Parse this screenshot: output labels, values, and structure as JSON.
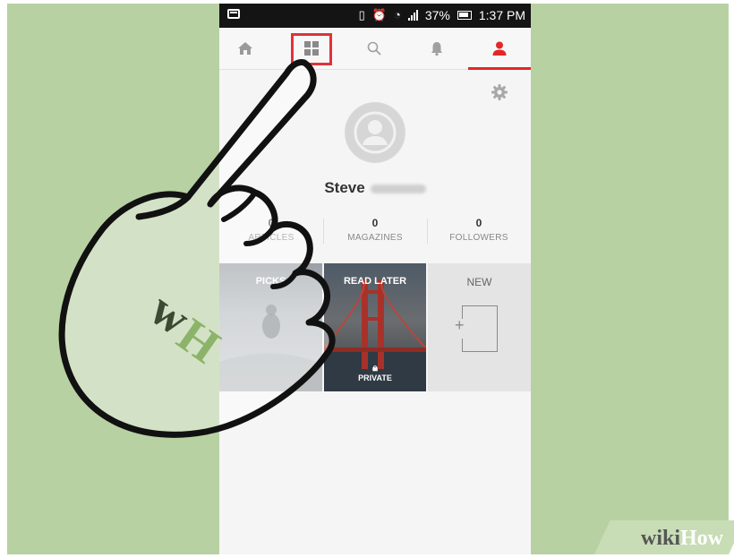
{
  "status_bar": {
    "battery": "37%",
    "time": "1:37 PM"
  },
  "tabs": [
    {
      "icon": "home-icon"
    },
    {
      "icon": "grid-icon"
    },
    {
      "icon": "search-icon"
    },
    {
      "icon": "bell-icon"
    },
    {
      "icon": "profile-icon"
    }
  ],
  "profile": {
    "name_first": "Steve",
    "stats": [
      {
        "value": "0",
        "label": "ARTICLES"
      },
      {
        "value": "0",
        "label": "MAGAZINES"
      },
      {
        "value": "0",
        "label": "FOLLOWERS"
      }
    ]
  },
  "magazines": [
    {
      "title": "PICKS"
    },
    {
      "title": "READ LATER",
      "badge": "PRIVATE"
    },
    {
      "title": "NEW"
    }
  ],
  "watermark": {
    "wiki": "wiki",
    "how": "How",
    "logo": "wH"
  },
  "colors": {
    "accent": "#e12828",
    "background": "#b8d1a3",
    "highlight": "#e0323a"
  }
}
